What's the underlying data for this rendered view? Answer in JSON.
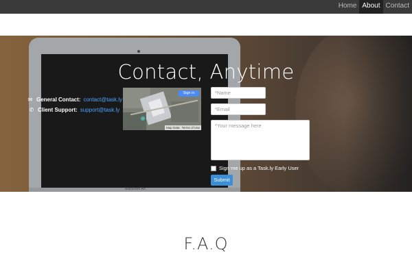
{
  "nav": {
    "items": [
      {
        "label": "Home",
        "active": false
      },
      {
        "label": "About",
        "active": true
      },
      {
        "label": "Contact",
        "active": false
      }
    ]
  },
  "hero": {
    "title": "Contact, Anytime",
    "laptop_brand": "MacBook Air",
    "contacts": [
      {
        "icon": "envelope-icon",
        "label": "General Contact:",
        "value": "contact@task.ly"
      },
      {
        "icon": "phone-icon",
        "label": "Client Support:",
        "value": "support@task.ly"
      }
    ],
    "map": {
      "signin_label": "Sign in",
      "footer_data": "Map Data",
      "footer_terms": "Terms of Use"
    },
    "form": {
      "name_placeholder": "*Name",
      "email_placeholder": "*Email",
      "message_placeholder": "*Your message here",
      "checkbox_label": "Sign me up as a Task.ly Early User",
      "submit_label": "Submit"
    }
  },
  "faq": {
    "title": "F.A.Q"
  },
  "colors": {
    "nav_bg": "#3a3a3a",
    "nav_active": "#222222",
    "link": "#4aa3ff",
    "submit": "#3b8fd8"
  }
}
